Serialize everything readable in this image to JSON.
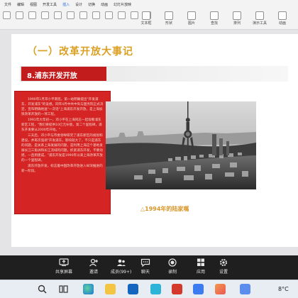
{
  "ribbon": {
    "tabs": [
      "文件",
      "编辑",
      "视图",
      "开发工具",
      "插入",
      "设计",
      "切换",
      "动画",
      "幻灯片放映"
    ],
    "tools": [
      {
        "label": "文本框",
        "icon": "textbox-icon"
      },
      {
        "label": "形状",
        "icon": "shape-icon"
      },
      {
        "label": "图片",
        "icon": "picture-icon"
      },
      {
        "label": "查找",
        "icon": "search-icon"
      },
      {
        "label": "排列",
        "icon": "arrange-icon"
      },
      {
        "label": "演示工具",
        "icon": "presentation-tools-icon"
      },
      {
        "label": "动画",
        "icon": "animation-icon"
      }
    ]
  },
  "slide": {
    "title": "（一）改革开放大事记",
    "section_heading": "8.浦东开发开放",
    "paragraphs": [
      "1990年1月邓小平南巡，第一站明确提出\"开发浦东，开发浦东\"的设想。同年4月中共中央与国务院正式决定，宣布明确地送\"一次话\"上海浦东开发开放，是上海加快改革开放的一项工程。",
      "1991年大年初一，邓小平在上海同志一起观看浦东新区工程，\"我们要提供10亿元补偿，第二个里程碑，浦东开发要从2000年开始。\"",
      "三天后，邓小平与市委领导研究了浦东新区的规划和建设，并再次强调\"开发浦东，影响就大了，不只是浦东的问题，是关系上海发展的问题，是利用上海这个基地发展长江三角洲和长江流域的问题。抓紧浦东开发，不要动摇，一直到建成。\"浦东开发是1990年以来上海改革开放的一个里程碑。",
      "浦东开放开发，标志着中国改革开放进入纵深推进的新一阶段。"
    ],
    "photo_caption": "△1994年的陆家嘴"
  },
  "meeting": {
    "items": [
      {
        "label": "共享屏幕",
        "icon": "share-screen-icon"
      },
      {
        "label": "邀请",
        "icon": "invite-icon"
      },
      {
        "label": "成员(99+)",
        "icon": "members-icon"
      },
      {
        "label": "聊天",
        "icon": "chat-icon"
      },
      {
        "label": "录制",
        "icon": "record-icon"
      },
      {
        "label": "应用",
        "icon": "apps-icon"
      },
      {
        "label": "设置",
        "icon": "settings-icon"
      }
    ]
  },
  "taskbar": {
    "temperature": "8°C",
    "apps": [
      "search-icon",
      "task-view-icon",
      "edge-icon",
      "file-explorer-icon",
      "mail-icon",
      "store-icon",
      "wps-icon",
      "meeting-icon",
      "photos-icon",
      "browser-icon"
    ]
  }
}
